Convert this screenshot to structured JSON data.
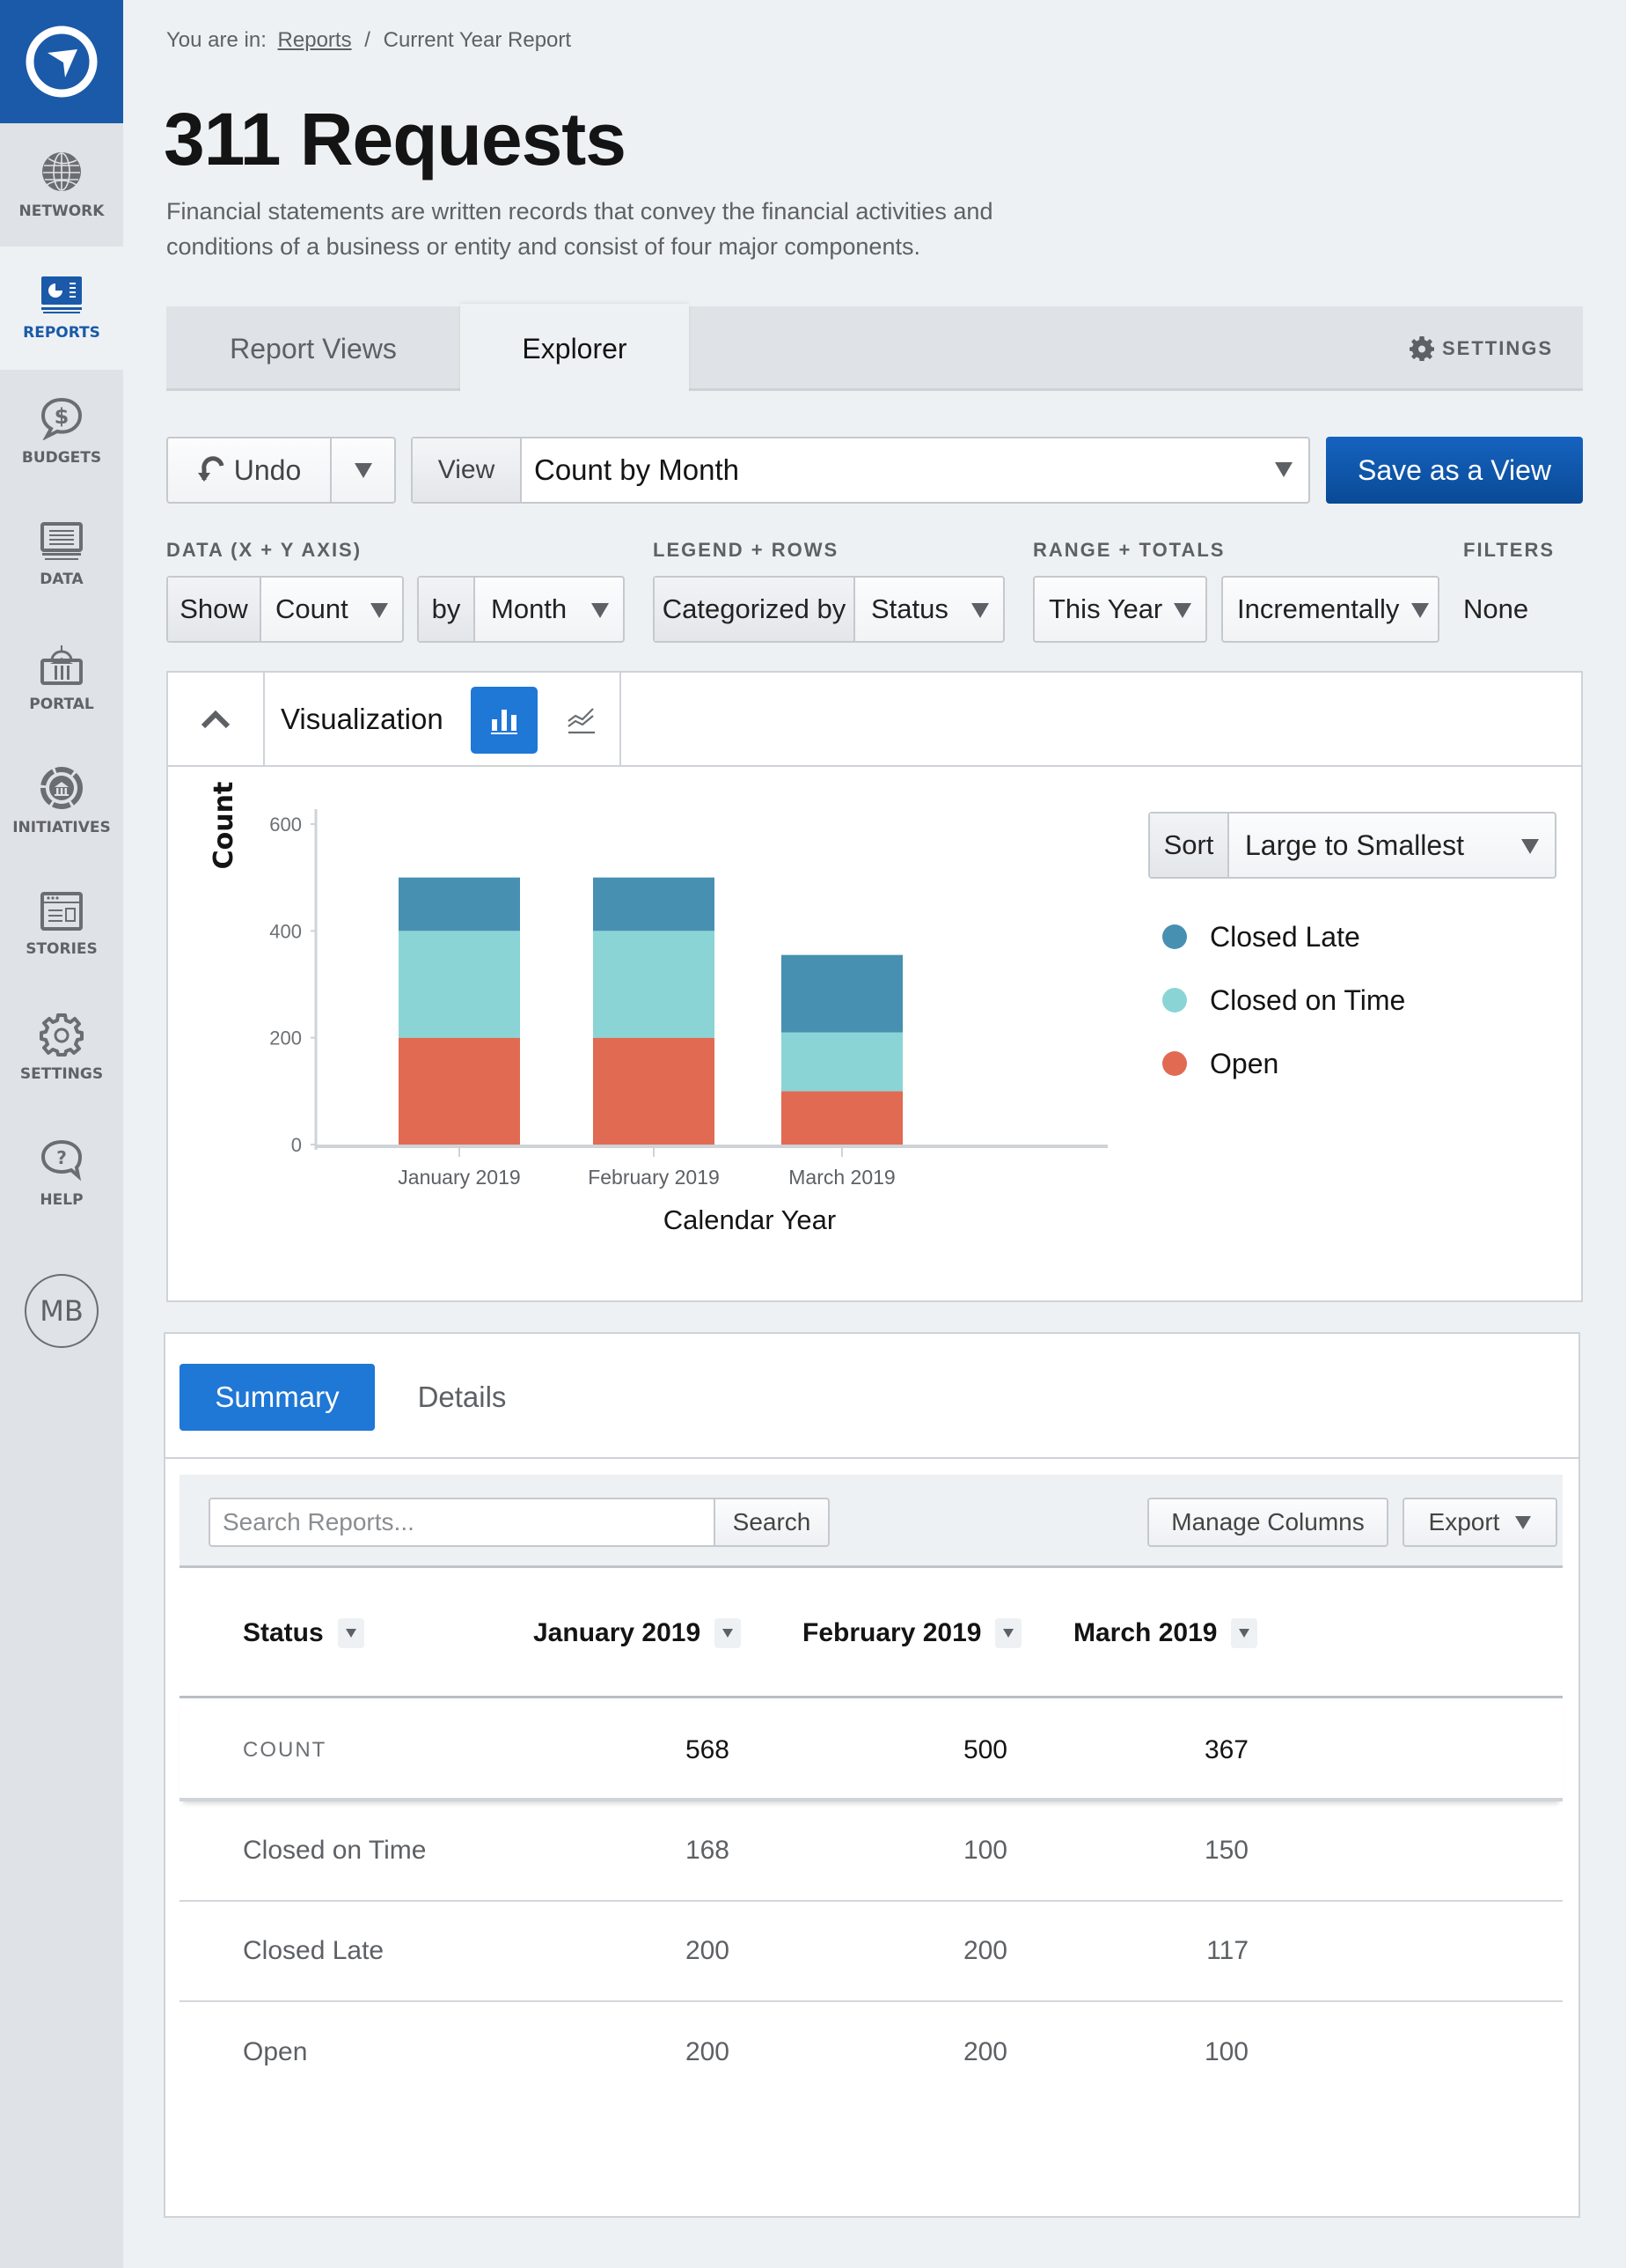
{
  "sidebar": {
    "logo": "app-logo",
    "items": [
      {
        "label": "NETWORK",
        "icon": "globe-icon",
        "active": false
      },
      {
        "label": "REPORTS",
        "icon": "reports-icon",
        "active": true
      },
      {
        "label": "BUDGETS",
        "icon": "budget-dollar-icon",
        "active": false
      },
      {
        "label": "DATA",
        "icon": "data-table-icon",
        "active": false
      },
      {
        "label": "PORTAL",
        "icon": "portal-building-icon",
        "active": false
      },
      {
        "label": "INITIATIVES",
        "icon": "initiatives-icon",
        "active": false
      },
      {
        "label": "STORIES",
        "icon": "stories-icon",
        "active": false
      },
      {
        "label": "SETTINGS",
        "icon": "gear-icon",
        "active": false
      },
      {
        "label": "HELP",
        "icon": "help-icon",
        "active": false
      }
    ],
    "avatar_initials": "MB"
  },
  "breadcrumb": {
    "prefix": "You are in:",
    "link": "Reports",
    "separator": "/",
    "current": "Current Year Report"
  },
  "page": {
    "title": "311 Requests",
    "description": "Financial statements are written records that convey the financial activities and conditions of a business or entity and consist of four major components."
  },
  "tabs": {
    "items": [
      {
        "label": "Report Views",
        "active": false
      },
      {
        "label": "Explorer",
        "active": true
      }
    ],
    "settings_label": "SETTINGS"
  },
  "toolbar": {
    "undo_label": "Undo",
    "view_prefix": "View",
    "view_value": "Count by Month",
    "save_label": "Save as a View"
  },
  "filters": {
    "data_label": "DATA (X + Y AXIS)",
    "legend_label": "LEGEND + ROWS",
    "range_label": "RANGE + TOTALS",
    "filters_label": "FILTERS",
    "show_prefix": "Show",
    "show_value": "Count",
    "by_prefix": "by",
    "by_value": "Month",
    "categorized_prefix": "Categorized by",
    "categorized_value": "Status",
    "range_value": "This Year",
    "totals_value": "Incrementally",
    "filters_value": "None"
  },
  "visualization": {
    "title": "Visualization",
    "chart_types": [
      {
        "name": "bar-chart",
        "active": true
      },
      {
        "name": "line-chart",
        "active": false
      }
    ],
    "sort_prefix": "Sort",
    "sort_value": "Large to Smallest"
  },
  "chart_data": {
    "type": "bar",
    "stacked": true,
    "title": "",
    "xlabel": "Calendar Year",
    "ylabel": "Count",
    "ylim": [
      0,
      600
    ],
    "yticks": [
      0,
      200,
      400,
      600
    ],
    "categories": [
      "January 2019",
      "February 2019",
      "March 2019"
    ],
    "series": [
      {
        "name": "Open",
        "color": "#e06a52",
        "values": [
          200,
          200,
          100
        ]
      },
      {
        "name": "Closed on Time",
        "color": "#8ad4d6",
        "values": [
          200,
          200,
          110
        ]
      },
      {
        "name": "Closed Late",
        "color": "#4790b1",
        "values": [
          100,
          100,
          145
        ]
      }
    ],
    "legend": [
      "Closed Late",
      "Closed on Time",
      "Open"
    ],
    "legend_position": "right",
    "grid": false
  },
  "summary": {
    "tabs": [
      {
        "label": "Summary",
        "active": true
      },
      {
        "label": "Details",
        "active": false
      }
    ],
    "search_placeholder": "Search Reports...",
    "search_value": "",
    "search_label": "Search",
    "manage_columns_label": "Manage Columns",
    "export_label": "Export",
    "columns": [
      "Status",
      "January 2019",
      "February 2019",
      "March 2019"
    ],
    "count_row": {
      "label": "COUNT",
      "values": [
        "568",
        "500",
        "367"
      ]
    },
    "rows": [
      {
        "label": "Closed on Time",
        "values": [
          "168",
          "100",
          "150"
        ]
      },
      {
        "label": "Closed Late",
        "values": [
          "200",
          "200",
          "117"
        ]
      },
      {
        "label": "Open",
        "values": [
          "200",
          "200",
          "100"
        ]
      }
    ]
  }
}
